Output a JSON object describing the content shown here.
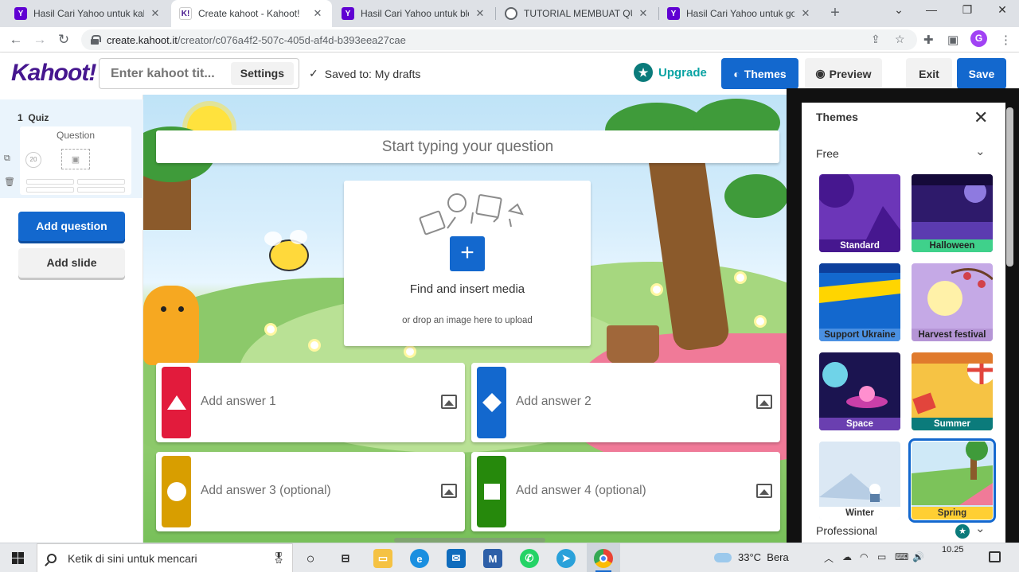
{
  "browser": {
    "tabs": [
      {
        "title": "Hasil Cari Yahoo untuk kahoot",
        "favicon": "yahoo-icon"
      },
      {
        "title": "Create kahoot - Kahoot!",
        "favicon": "kahoot-icon",
        "active": true
      },
      {
        "title": "Hasil Cari Yahoo untuk blog",
        "favicon": "yahoo-icon"
      },
      {
        "title": "TUTORIAL MEMBUAT QUIS D",
        "favicon": "globe-icon"
      },
      {
        "title": "Hasil Cari Yahoo untuk goog",
        "favicon": "yahoo-icon"
      }
    ],
    "url_host": "create.kahoot.it",
    "url_path": "/creator/c076a4f2-507c-405d-af4d-b393eea27cae",
    "profile_initial": "G"
  },
  "header": {
    "logo": "Kahoot!",
    "title_placeholder": "Enter kahoot tit...",
    "settings_label": "Settings",
    "saved_label": "Saved to: My drafts",
    "upgrade_label": "Upgrade",
    "themes_label": "Themes",
    "preview_label": "Preview",
    "exit_label": "Exit",
    "save_label": "Save"
  },
  "sidebar": {
    "slide_number": "1",
    "slide_type": "Quiz",
    "thumb_label": "Question",
    "thumb_timer": "20",
    "add_question_label": "Add question",
    "add_slide_label": "Add slide"
  },
  "editor": {
    "question_placeholder": "Start typing your question",
    "media_title": "Find and insert media",
    "media_subtitle": "or drop an image here to upload",
    "answers": [
      {
        "label": "Add answer 1",
        "shape": "triangle",
        "color": "#e21b3c"
      },
      {
        "label": "Add answer 2",
        "shape": "diamond",
        "color": "#1368ce"
      },
      {
        "label": "Add answer 3 (optional)",
        "shape": "circle",
        "color": "#d89e00"
      },
      {
        "label": "Add answer 4 (optional)",
        "shape": "square",
        "color": "#26890c"
      }
    ]
  },
  "themes_panel": {
    "title": "Themes",
    "section_free": "Free",
    "themes": [
      {
        "name": "Standard",
        "color": "#46178f"
      },
      {
        "name": "Halloween",
        "color": "#2e1a6b"
      },
      {
        "name": "Support Ukraine",
        "color": "#1368ce"
      },
      {
        "name": "Harvest festival",
        "color": "#b595d6"
      },
      {
        "name": "Space",
        "color": "#1b1450"
      },
      {
        "name": "Summer",
        "color": "#f6c344"
      },
      {
        "name": "Winter",
        "color": "#c8dcee"
      },
      {
        "name": "Spring",
        "color": "#8fcf6a",
        "selected": true
      }
    ],
    "section_professional": "Professional"
  },
  "taskbar": {
    "search_placeholder": "Ketik di sini untuk mencari",
    "weather": "33°C",
    "weather_desc": "Bera",
    "time": "10.25"
  },
  "colors": {
    "kahoot_purple": "#46178f",
    "primary_blue": "#1368ce",
    "teal": "#0aa3a3"
  }
}
